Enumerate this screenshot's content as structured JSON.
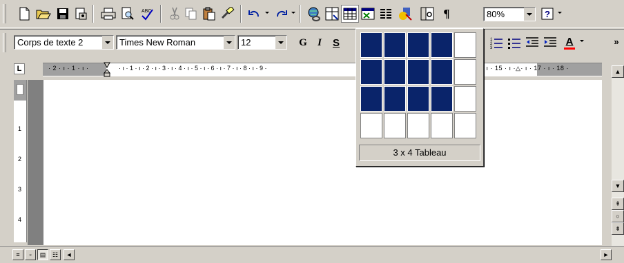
{
  "toolbar_standard": {
    "zoom_value": "80%",
    "buttons": [
      "new-document",
      "open",
      "save",
      "permission",
      "print",
      "print-preview",
      "spelling",
      "cut",
      "copy",
      "paste",
      "format-painter",
      "undo",
      "redo",
      "hyperlink",
      "tables-borders",
      "insert-table",
      "insert-excel",
      "columns",
      "drawing",
      "document-map",
      "show-hide",
      "zoom",
      "help"
    ]
  },
  "toolbar_formatting": {
    "style_value": "Corps de texte 2",
    "font_value": "Times New Roman",
    "size_value": "12",
    "bold_label": "G",
    "italic_label": "I",
    "underline_label": "S",
    "font_color_label": "A",
    "overflow_label": "»"
  },
  "ruler": {
    "tab_selector": "L",
    "h_left": "· 2 · ı · 1 · ı ·",
    "h_main": "· ı · 1 · ı · 2 · ı · 3 · ı · 4 · ı · 5 · ı · 6 · ı · 7 · ı · 8 · ı · 9 ·",
    "h_right": "· ı · 15 · ı ·△· ı · 17 · ı · 18 ·",
    "v_marks": [
      "1",
      "2",
      "3",
      "4"
    ]
  },
  "table_picker": {
    "rows": 4,
    "cols": 5,
    "selected_rows": 3,
    "selected_cols": 4,
    "label": "3 x 4 Tableau",
    "highlight_color": "#0a246a"
  }
}
